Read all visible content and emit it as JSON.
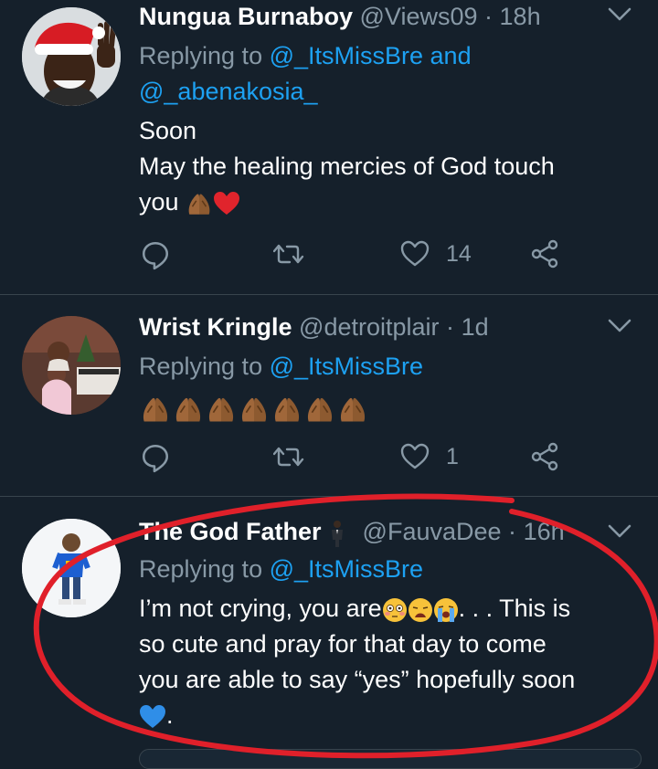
{
  "tweets": [
    {
      "name": "Nungua Burnaboy",
      "handle": "@Views09",
      "sep": "·",
      "time": "18h",
      "replying_prefix": "Replying to ",
      "mentions": [
        "@_ItsMissBre",
        "@_abenakosia_"
      ],
      "mention_joiner": " and",
      "text_lines": [
        "Soon",
        "May the healing mercies of God touch",
        "you"
      ],
      "text_emojis": [
        "folded-hands-emoji",
        "red-heart-emoji"
      ],
      "like_count": "14"
    },
    {
      "name": "Wrist Kringle",
      "handle": "@detroitplair",
      "sep": "·",
      "time": "1d",
      "replying_prefix": "Replying to ",
      "mentions": [
        "@_ItsMissBre"
      ],
      "text_emojis": [
        "folded-hands-emoji",
        "folded-hands-emoji",
        "folded-hands-emoji",
        "folded-hands-emoji",
        "folded-hands-emoji",
        "folded-hands-emoji",
        "folded-hands-emoji"
      ],
      "like_count": "1"
    },
    {
      "name": "The God Father",
      "name_emoji": "man-in-suit-emoji",
      "handle": "@FauvaDee",
      "sep": "·",
      "time": "16h",
      "replying_prefix": "Replying to ",
      "mentions": [
        "@_ItsMissBre"
      ],
      "text_part1": "I’m not crying, you are",
      "text_part2": ". . . This is",
      "text_line2": "so cute and pray for that day to come",
      "text_line3": "you are able to say “yes” hopefully soon",
      "text_line4_end": ".",
      "text_emojis": [
        "flushed-face-emoji",
        "weary-face-emoji",
        "loudly-crying-face-emoji",
        "blue-heart-emoji"
      ]
    }
  ],
  "colors": {
    "background": "#15202b",
    "secondary_text": "#8899a6",
    "mention": "#1da1f2",
    "divider": "#38444d",
    "annotation_red": "#e0202a"
  }
}
